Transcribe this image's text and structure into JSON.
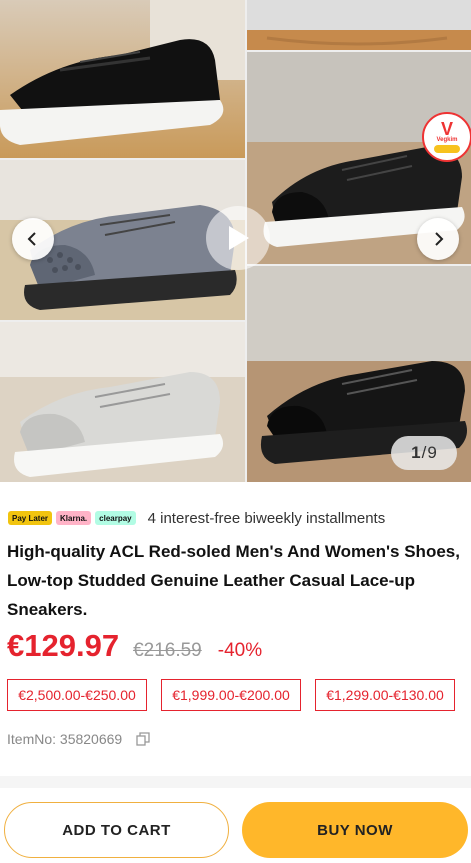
{
  "gallery": {
    "counter_current": "1",
    "counter_separator": "/",
    "counter_total": "9",
    "badge_letter": "V",
    "badge_label": "Vegkim"
  },
  "payment": {
    "chips": [
      "Pay Later",
      "Klarna.",
      "clearpay"
    ],
    "installment_text": "4 interest-free biweekly installments"
  },
  "product": {
    "title": "High-quality ACL Red-soled Men's And Women's Shoes, Low-top Studded Genuine Leather Casual Lace-up Sneakers.",
    "price": "€129.97",
    "old_price": "€216.59",
    "discount": "-40%",
    "tiers": [
      "€2,500.00-€250.00",
      "€1,999.00-€200.00",
      "€1,299.00-€130.00"
    ],
    "item_no": "ItemNo: 35820669"
  },
  "actions": {
    "add_to_cart": "ADD TO CART",
    "buy_now": "BUY NOW"
  },
  "colors": {
    "accent_red": "#e5232e",
    "buy_button": "#ffb72a"
  }
}
